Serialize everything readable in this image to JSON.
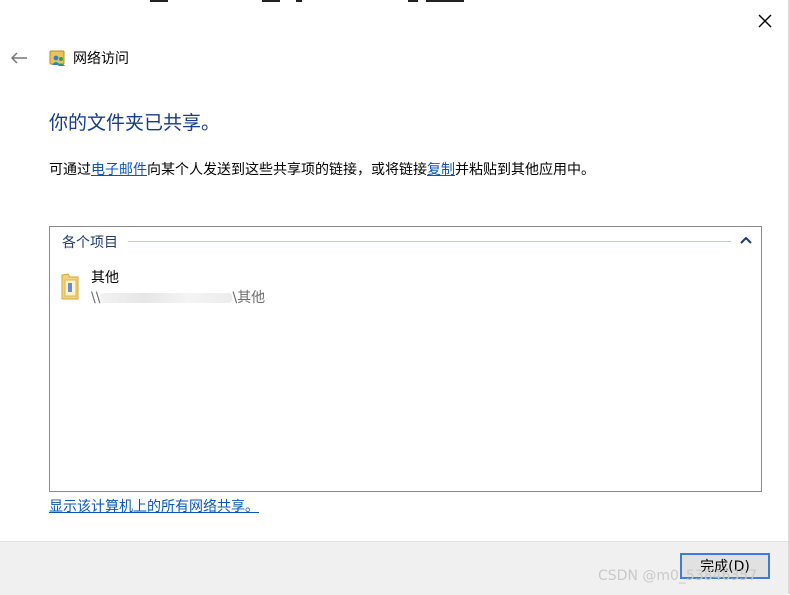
{
  "window": {
    "title": "网络访问"
  },
  "heading": "你的文件夹已共享。",
  "description": {
    "prefix": "可通过",
    "email_link": "电子邮件",
    "middle": "向某个人发送到这些共享项的链接，或将链接",
    "copy_link": "复制",
    "suffix": "并粘贴到其他应用中。"
  },
  "items_group": {
    "header": "各个项目",
    "items": [
      {
        "name": "其他",
        "path_prefix": "\\\\",
        "path_suffix": "\\其他"
      }
    ]
  },
  "show_all_link": "显示该计算机上的所有网络共享。",
  "footer": {
    "finish_label": "完成(D)"
  },
  "watermark": "CSDN @m0_53846357",
  "icons": {
    "back": "back-arrow-icon",
    "close": "close-icon",
    "title": "network-share-icon",
    "collapse": "chevron-up-icon",
    "folder": "folder-icon"
  },
  "colors": {
    "heading": "#173a8b",
    "link": "#0a55b6",
    "button_border": "#3b7dd8",
    "footer_bg": "#f0f0f0"
  }
}
